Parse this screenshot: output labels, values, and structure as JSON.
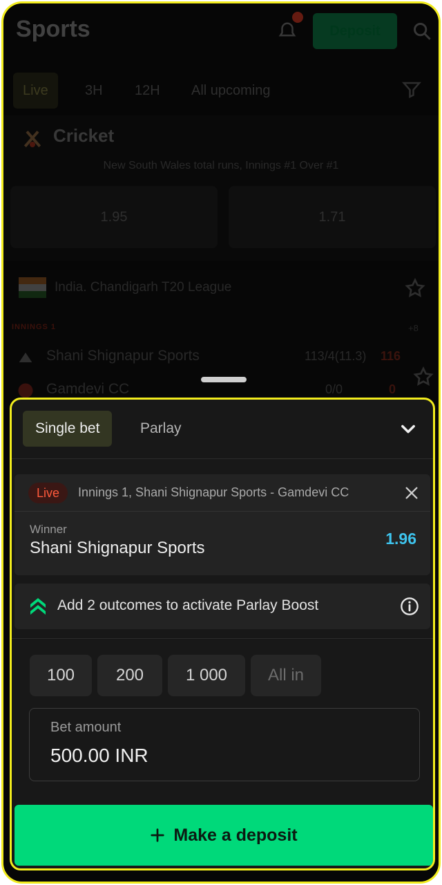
{
  "background": {
    "title": "Sports",
    "deposit_label": "Deposit",
    "tabs": [
      "Live",
      "3H",
      "12H",
      "All upcoming"
    ],
    "sport": "Cricket",
    "match_info": "New South Wales total runs, Innings #1 Over #1",
    "odds": [
      {
        "value": "1.95"
      },
      {
        "value": "1.71"
      }
    ],
    "league": "India. Chandigarh T20 League",
    "live_label": "INNINGS 1",
    "more": "+8",
    "teams": [
      {
        "name": "Shani Shignapur Sports",
        "score": "113/4(11.3)",
        "hot": "116"
      },
      {
        "name": "Gamdevi CC",
        "score": "0/0",
        "hot": "0"
      }
    ]
  },
  "betslip": {
    "tabs": {
      "single": "Single bet",
      "parlay": "Parlay"
    },
    "active_tab": "single",
    "selection": {
      "live_badge": "Live",
      "event": "Innings 1, Shani Shignapur Sports - Gamdevi CC",
      "market": "Winner",
      "outcome": "Shani Shignapur Sports",
      "odds": "1.96"
    },
    "boost_text": "Add 2 outcomes to activate Parlay Boost",
    "quick_amounts": [
      "100",
      "200",
      "1 000",
      "All in"
    ],
    "bet_amount_label": "Bet amount",
    "bet_amount_value": "500.00 INR",
    "action_label": "Make a deposit"
  },
  "colors": {
    "accent_green": "#00d97a",
    "odds_blue": "#3ec4ee",
    "live_red": "#ff5a3c",
    "highlight_yellow": "#f2ec1d"
  }
}
